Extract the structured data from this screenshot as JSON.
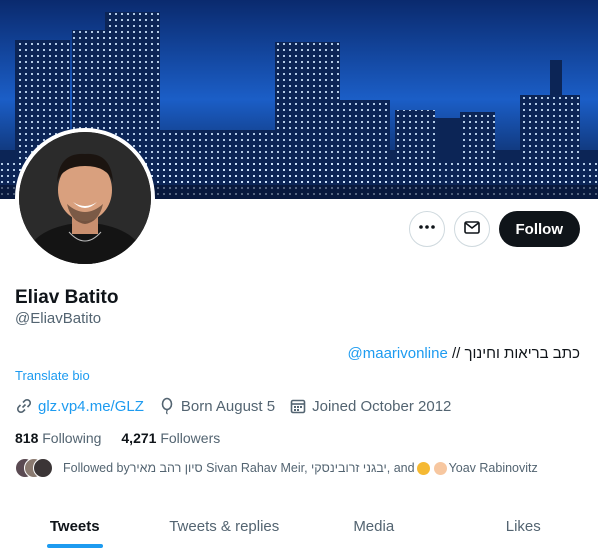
{
  "profile": {
    "name": "Eliav Batito",
    "handle": "@EliavBatito",
    "bio_mention": "@maarivonline",
    "bio_text": "כתב בריאות וחינוך // ",
    "translate_label": "Translate bio",
    "link_text": "glz.vp4.me/GLZ",
    "born": "Born August 5",
    "joined": "Joined October 2012"
  },
  "actions": {
    "follow_label": "Follow",
    "more_icon": "more-icon",
    "message_icon": "envelope-icon"
  },
  "stats": {
    "following_count": "818",
    "following_label": "Following",
    "followers_count": "4,271",
    "followers_label": "Followers"
  },
  "followed_by": {
    "prefix": "Followed by ",
    "names": "סיון רהב מאיר Sivan Rahav Meir, יבגני זרובינסקי, and ",
    "last_name": " Yoav Rabinovitz"
  },
  "tabs": [
    "Tweets",
    "Tweets & replies",
    "Media",
    "Likes"
  ],
  "colors": {
    "accent": "#1d9bf0",
    "follow_bg": "#0f1419",
    "muted": "#536471"
  }
}
